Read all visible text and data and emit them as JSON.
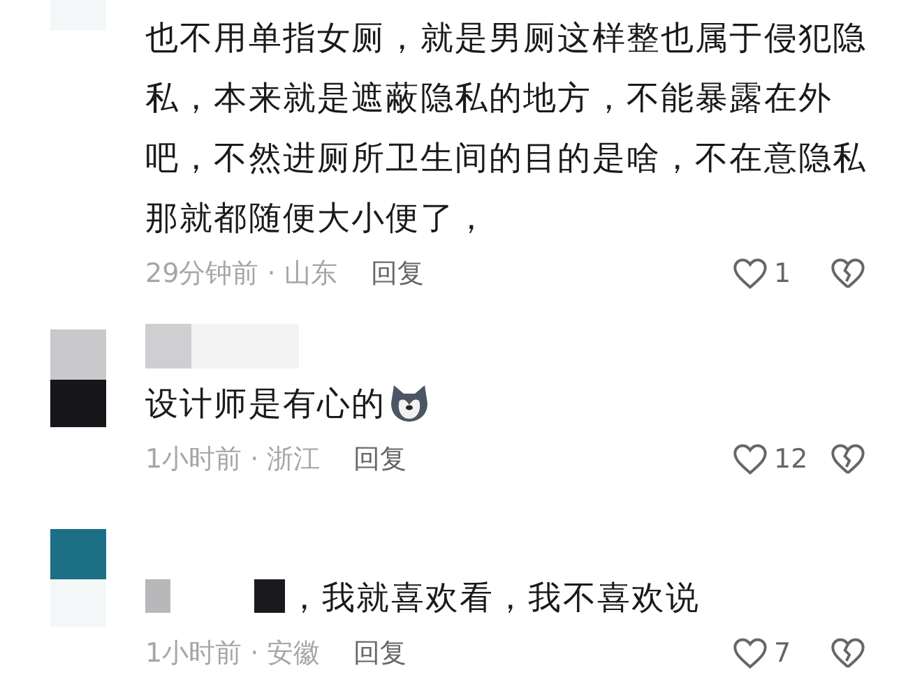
{
  "comments": [
    {
      "parts": [
        {
          "kind": "text",
          "text": "也不用单指女厕，就是男厕这样整也属于侵犯隐私，本来就是遮蔽隐私的地方，不能暴露在外吧，不然进厕所卫生间的目的是啥，不在意隐私那就都随便大小便了，"
        }
      ],
      "meta": "29分钟前 · 山东",
      "reply": "回复",
      "likes": "1",
      "liked": false
    },
    {
      "name": {
        "kind": "redacted"
      },
      "parts": [
        {
          "kind": "text",
          "text": "设计师是有心的"
        },
        {
          "kind": "emoji"
        }
      ],
      "meta": "1小时前 · 浙江",
      "reply": "回复",
      "likes": "12",
      "liked": false
    },
    {
      "parts": [
        {
          "kind": "redacted"
        },
        {
          "kind": "text",
          "text": "，我就喜欢看，我不喜欢说"
        }
      ],
      "meta": "1小时前 · 安徽",
      "reply": "回复",
      "likes": "7",
      "liked": false
    }
  ]
}
